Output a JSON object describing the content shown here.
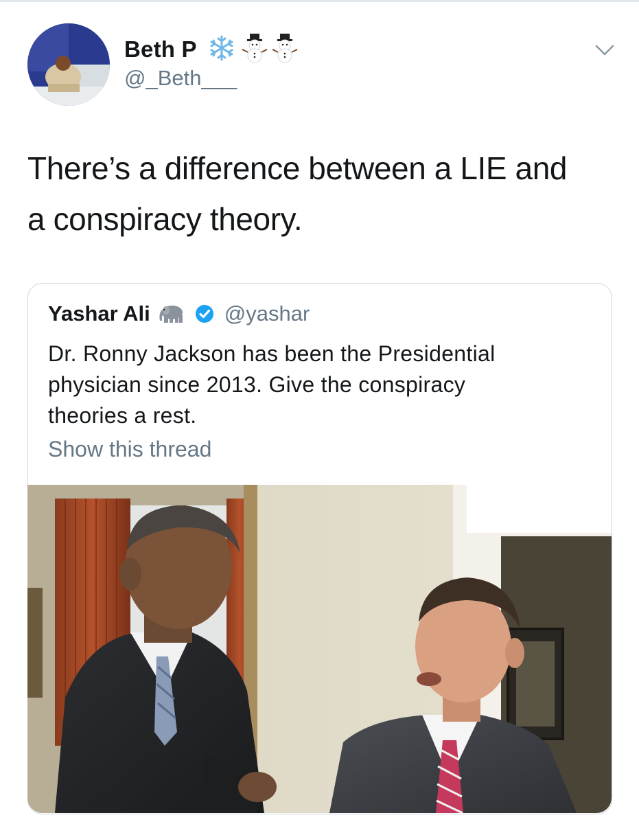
{
  "author": {
    "display_name": "Beth P",
    "handle": "@_Beth___",
    "name_emoji": [
      "❄",
      "☃",
      "☃"
    ]
  },
  "tweet": {
    "text_lines": [
      "There’s a difference between a LIE and",
      "a conspiracy theory."
    ]
  },
  "quoted": {
    "display_name": "Yashar Ali",
    "name_emoji": "elephant",
    "verified": true,
    "handle": "@yashar",
    "text_lines": [
      "Dr. Ronny Jackson has been the Presidential",
      "physician since 2013. Give the conspiracy",
      "theories a rest."
    ],
    "show_thread": "Show this thread"
  },
  "colors": {
    "text": "#14171a",
    "secondary": "#657786",
    "border": "#ccd6dd",
    "verified": "#1da1f2"
  },
  "icons": {
    "menu": "chevron-down-icon",
    "verified": "verified-badge-icon",
    "name_emoji": "snowflake-icon"
  }
}
